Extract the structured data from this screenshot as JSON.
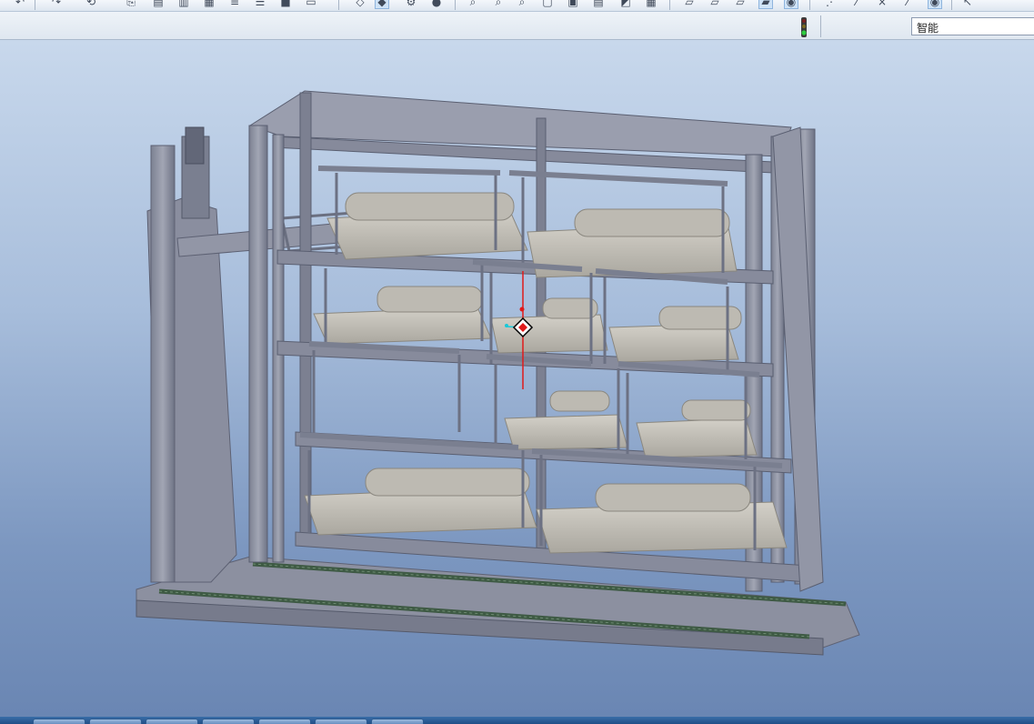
{
  "toolbar": {
    "icons": [
      "undo-icon",
      "redo-icon",
      "regenerate-icon",
      "copy-icon",
      "paste-icon",
      "paste-special-icon",
      "mirror-icon",
      "layer-icon",
      "model-tree-icon",
      "window-icon",
      "repaint-icon",
      "spin-center-icon",
      "orient-icon",
      "shade-icon",
      "view-manager-icon",
      "zoom-in-icon",
      "zoom-out-icon",
      "refit-icon",
      "named-views-icon",
      "saved-views-icon",
      "view-style-icon",
      "layers-icon",
      "display-wireframe-icon",
      "display-hidden-icon",
      "display-no-hidden-icon",
      "display-shaded-icon",
      "display-enhanced-icon",
      "datum-planes-icon",
      "datum-axes-icon",
      "datum-points-icon",
      "coordinate-systems-icon",
      "annotation-icon",
      "select-icon"
    ],
    "active_icons": [
      "spin-center-icon",
      "display-shaded-icon",
      "annotation-icon"
    ]
  },
  "statusbar": {
    "selection_filter": "智能"
  },
  "colors": {
    "viewport_top": "#c8d8ec",
    "viewport_bottom": "#6a86b3",
    "frame_steel": "#8e93a3",
    "frame_dark": "#6f7486",
    "tray": "#c2bfb7",
    "rail": "#3e5a44",
    "axis_red": "#e01b1b",
    "axis_cyan": "#19c8d8"
  }
}
